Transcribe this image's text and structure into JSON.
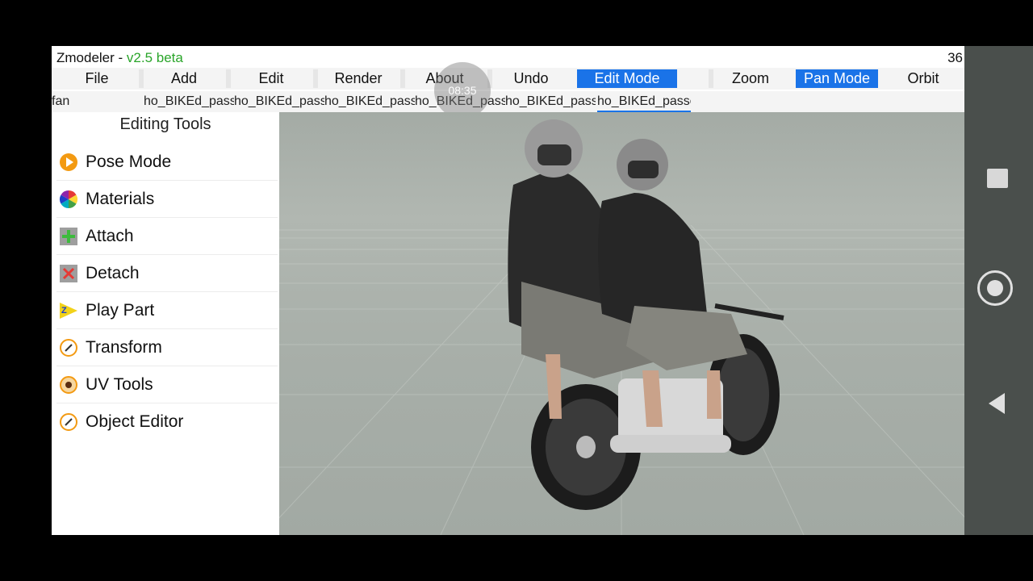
{
  "window": {
    "app_name": "Zmodeler - ",
    "version": "v2.5 beta",
    "fps": "36"
  },
  "menu": [
    {
      "label": "File",
      "active": false
    },
    {
      "label": "Add",
      "active": false
    },
    {
      "label": "Edit",
      "active": false
    },
    {
      "label": "Render",
      "active": false
    },
    {
      "label": "About",
      "active": false
    },
    {
      "label": "Undo",
      "active": false
    },
    {
      "label": "Edit Mode",
      "active": true
    },
    {
      "label": "Zoom",
      "active": false
    },
    {
      "label": "Pan Mode",
      "active": true
    },
    {
      "label": "Orbit",
      "active": false
    }
  ],
  "tabs": [
    {
      "label": "fan"
    },
    {
      "label": "ho_BIKEd_passe"
    },
    {
      "label": "ho_BIKEd_passe"
    },
    {
      "label": "ho_BIKEd_passe"
    },
    {
      "label": "ho_BIKEd_passe"
    },
    {
      "label": "ho_BIKEd_passe"
    },
    {
      "label": "ho_BIKEd_passe"
    }
  ],
  "recording_timer": "08:35",
  "sidebar": {
    "title": "Editing Tools",
    "tools": [
      {
        "label": "Pose Mode",
        "icon": "pose-mode-icon"
      },
      {
        "label": "Materials",
        "icon": "color-wheel-icon"
      },
      {
        "label": "Attach",
        "icon": "plus-icon"
      },
      {
        "label": "Detach",
        "icon": "x-icon"
      },
      {
        "label": "Play Part",
        "icon": "play-part-icon"
      },
      {
        "label": "Transform",
        "icon": "pencil-icon"
      },
      {
        "label": "UV Tools",
        "icon": "uv-tools-icon"
      },
      {
        "label": "Object Editor",
        "icon": "pencil-icon"
      }
    ]
  },
  "viewport": {
    "scene": "3D model of two riders on a motorcycle"
  },
  "colors": {
    "accent": "#1a73e8",
    "version_green": "#2aa52a",
    "viewport_bg": "#a9afa9"
  }
}
